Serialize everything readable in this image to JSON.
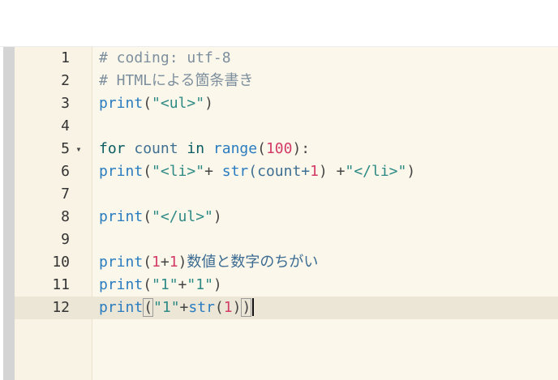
{
  "editor": {
    "current_line": 12,
    "lines": [
      {
        "number": "1",
        "segments": [
          {
            "text": "# coding: utf-8",
            "kind": "comment"
          }
        ]
      },
      {
        "number": "2",
        "segments": [
          {
            "text": "# HTMLによる箇条書き",
            "kind": "comment"
          }
        ]
      },
      {
        "number": "3",
        "segments": [
          {
            "text": "print",
            "kind": "builtin"
          },
          {
            "text": "(",
            "kind": "op"
          },
          {
            "text": "\"<ul>\"",
            "kind": "string"
          },
          {
            "text": ")",
            "kind": "op"
          }
        ]
      },
      {
        "number": "4",
        "segments": []
      },
      {
        "number": "5",
        "fold": "▾",
        "segments": [
          {
            "text": "for",
            "kind": "kw"
          },
          {
            "text": " count ",
            "kind": "plain"
          },
          {
            "text": "in",
            "kind": "kw"
          },
          {
            "text": " ",
            "kind": "plain"
          },
          {
            "text": "range",
            "kind": "builtin"
          },
          {
            "text": "(",
            "kind": "op"
          },
          {
            "text": "100",
            "kind": "number"
          },
          {
            "text": "):",
            "kind": "op"
          }
        ]
      },
      {
        "number": "6",
        "segments": [
          {
            "text": "    ",
            "kind": "plain"
          },
          {
            "text": "print",
            "kind": "builtin"
          },
          {
            "text": "(",
            "kind": "op"
          },
          {
            "text": "\"<li>\"",
            "kind": "string"
          },
          {
            "text": "+ ",
            "kind": "op"
          },
          {
            "text": "str",
            "kind": "builtin"
          },
          {
            "text": "(count+",
            "kind": "plain"
          },
          {
            "text": "1",
            "kind": "number"
          },
          {
            "text": ") +",
            "kind": "op"
          },
          {
            "text": "\"</li>\"",
            "kind": "string"
          },
          {
            "text": ")",
            "kind": "op"
          }
        ]
      },
      {
        "number": "7",
        "segments": []
      },
      {
        "number": "8",
        "segments": [
          {
            "text": "print",
            "kind": "builtin"
          },
          {
            "text": "(",
            "kind": "op"
          },
          {
            "text": "\"</ul>\"",
            "kind": "string"
          },
          {
            "text": ")",
            "kind": "op"
          }
        ]
      },
      {
        "number": "9",
        "segments": []
      },
      {
        "number": "10",
        "segments": [
          {
            "text": "print",
            "kind": "builtin"
          },
          {
            "text": "(",
            "kind": "op"
          },
          {
            "text": "1",
            "kind": "number"
          },
          {
            "text": "+",
            "kind": "op"
          },
          {
            "text": "1",
            "kind": "number"
          },
          {
            "text": ")",
            "kind": "op"
          },
          {
            "text": "数値と数字のちがい",
            "kind": "jp"
          }
        ]
      },
      {
        "number": "11",
        "segments": [
          {
            "text": "print",
            "kind": "builtin"
          },
          {
            "text": "(",
            "kind": "op"
          },
          {
            "text": "\"1\"",
            "kind": "string"
          },
          {
            "text": "+",
            "kind": "op"
          },
          {
            "text": "\"1\"",
            "kind": "string"
          },
          {
            "text": ")",
            "kind": "op"
          }
        ]
      },
      {
        "number": "12",
        "segments": [
          {
            "text": "print",
            "kind": "builtin"
          },
          {
            "text": "(",
            "kind": "op",
            "match": true
          },
          {
            "text": "\"1\"",
            "kind": "string"
          },
          {
            "text": "+",
            "kind": "op"
          },
          {
            "text": "str",
            "kind": "builtin"
          },
          {
            "text": "(",
            "kind": "op"
          },
          {
            "text": "1",
            "kind": "number"
          },
          {
            "text": ")",
            "kind": "op"
          },
          {
            "text": ")",
            "kind": "op",
            "match": true
          }
        ],
        "cursor": true
      }
    ]
  },
  "colors": {
    "editor_background": "#fbf7ea",
    "gutter_background": "#f8f3e4",
    "current_line_highlight": "#ebe6d6",
    "scrollbar": "#d4d4d4"
  }
}
